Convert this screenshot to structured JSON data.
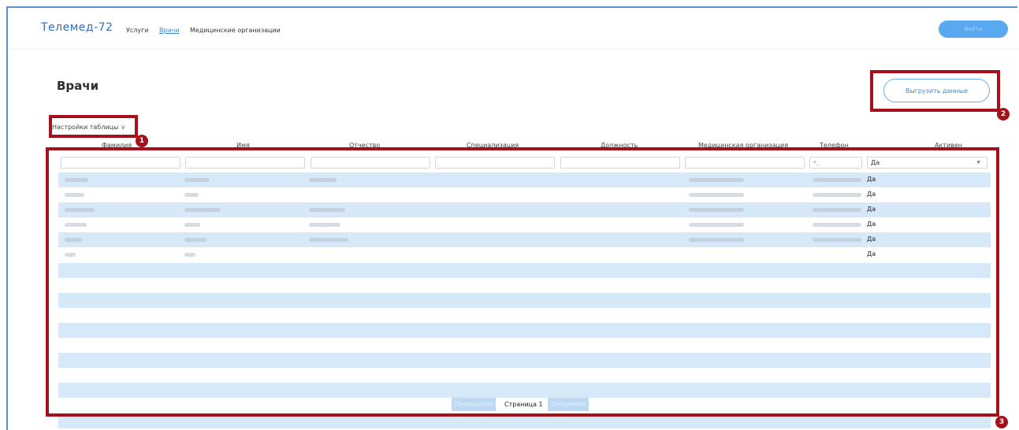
{
  "header": {
    "logo": "Телемед-72",
    "nav": [
      "Услуги",
      "Врачи",
      "Медицинские организации"
    ],
    "active_nav": "Врачи",
    "login_label": "Войти"
  },
  "page": {
    "title": "Врачи",
    "export_label": "Выгрузить данные",
    "settings_label": "Настройки таблицы"
  },
  "table": {
    "columns": [
      "Фамилия",
      "Имя",
      "Отчество",
      "Специализация",
      "Должность",
      "Медицинская организация",
      "Телефон",
      "Активен"
    ],
    "phone_placeholder": "+_",
    "active_filter": "Да",
    "rows": [
      {
        "active": "Да"
      },
      {
        "active": "Да"
      },
      {
        "active": "Да"
      },
      {
        "active": "Да"
      },
      {
        "active": "Да"
      },
      {
        "active": "Да"
      }
    ]
  },
  "pager": {
    "prev": "Предыдущая",
    "page": "Страница 1",
    "next": "Следующая"
  },
  "callouts": [
    "1",
    "2",
    "3"
  ],
  "colors": {
    "accent": "#3c86d6",
    "highlight": "#a5111b",
    "row_shade": "#d7e8f8"
  }
}
